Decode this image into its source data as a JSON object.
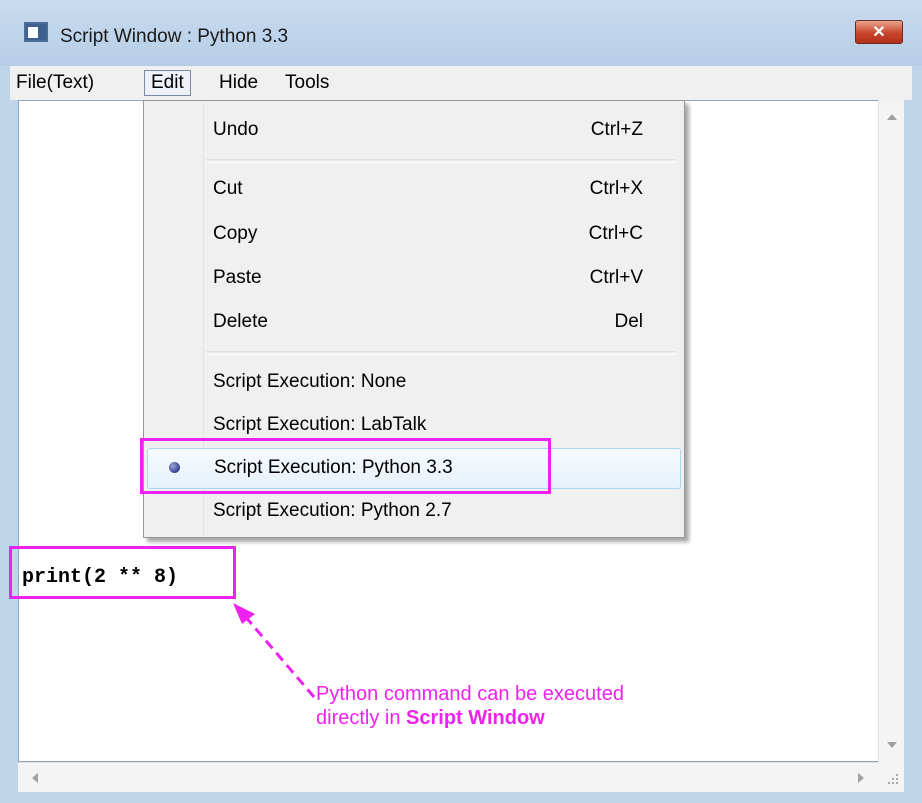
{
  "window": {
    "title": "Script Window : Python 3.3",
    "close_label": "✕"
  },
  "menubar": {
    "items": [
      "File(Text)",
      "Edit",
      "Hide",
      "Tools"
    ],
    "active": "Edit"
  },
  "edit_menu": {
    "items": [
      {
        "label": "Undo",
        "shortcut": "Ctrl+Z"
      },
      {
        "label": "Cut",
        "shortcut": "Ctrl+X"
      },
      {
        "label": "Copy",
        "shortcut": "Ctrl+C"
      },
      {
        "label": "Paste",
        "shortcut": "Ctrl+V"
      },
      {
        "label": "Delete",
        "shortcut": "Del"
      },
      {
        "label": "Script Execution: None",
        "shortcut": ""
      },
      {
        "label": "Script Execution: LabTalk",
        "shortcut": ""
      },
      {
        "label": "Script Execution: Python 3.3",
        "shortcut": "",
        "checked": true
      },
      {
        "label": "Script Execution: Python 2.7",
        "shortcut": ""
      }
    ]
  },
  "editor": {
    "code": "print(2 ** 8)"
  },
  "annotation": {
    "line1": "Python command can be executed",
    "line2_prefix": "directly in ",
    "line2_bold": "Script Window",
    "color": "#ee22ee"
  }
}
